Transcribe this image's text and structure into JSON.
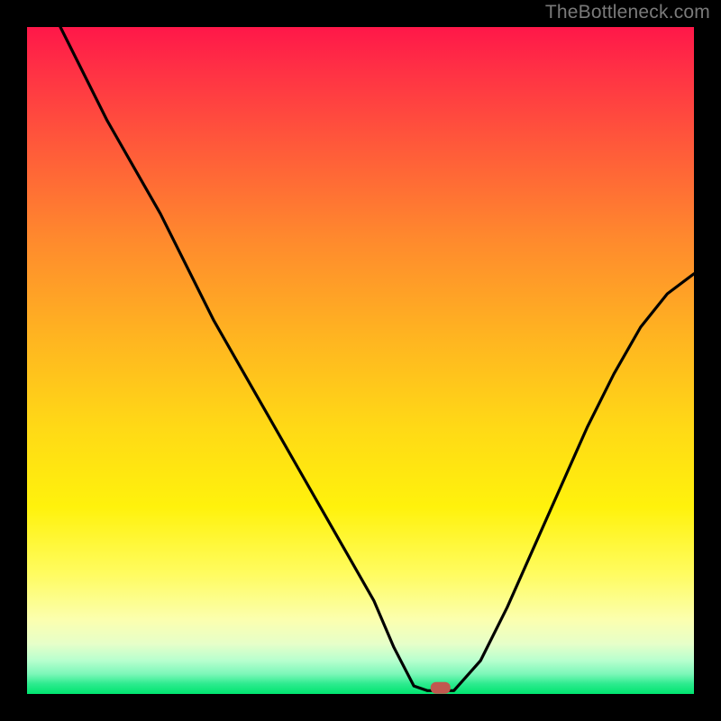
{
  "watermark": "TheBottleneck.com",
  "chart_data": {
    "type": "line",
    "title": "",
    "xlabel": "",
    "ylabel": "",
    "xlim": [
      0,
      100
    ],
    "ylim": [
      0,
      100
    ],
    "grid": false,
    "series": [
      {
        "name": "bottleneck-curve",
        "x": [
          5,
          8,
          12,
          16,
          20,
          24,
          28,
          32,
          36,
          40,
          44,
          48,
          52,
          55,
          58,
          60,
          64,
          68,
          72,
          76,
          80,
          84,
          88,
          92,
          96,
          100
        ],
        "y": [
          100,
          94,
          86,
          79,
          72,
          64,
          56,
          49,
          42,
          35,
          28,
          21,
          14,
          7,
          1.2,
          0.5,
          0.5,
          5,
          13,
          22,
          31,
          40,
          48,
          55,
          60,
          63
        ]
      }
    ],
    "marker": {
      "x": 62,
      "y": 0.9,
      "color": "#c1584f"
    },
    "gradient_stops": [
      {
        "pos": 0,
        "color": "#ff1749"
      },
      {
        "pos": 6,
        "color": "#ff2f45"
      },
      {
        "pos": 18,
        "color": "#ff5a3a"
      },
      {
        "pos": 32,
        "color": "#ff8a2d"
      },
      {
        "pos": 46,
        "color": "#ffb321"
      },
      {
        "pos": 60,
        "color": "#ffd916"
      },
      {
        "pos": 72,
        "color": "#fff20c"
      },
      {
        "pos": 82,
        "color": "#fffc60"
      },
      {
        "pos": 89,
        "color": "#fbffb0"
      },
      {
        "pos": 92.5,
        "color": "#e6ffc9"
      },
      {
        "pos": 95,
        "color": "#b7ffce"
      },
      {
        "pos": 97,
        "color": "#7cf7b9"
      },
      {
        "pos": 98.5,
        "color": "#2ceb8e"
      },
      {
        "pos": 100,
        "color": "#00e46f"
      }
    ]
  }
}
